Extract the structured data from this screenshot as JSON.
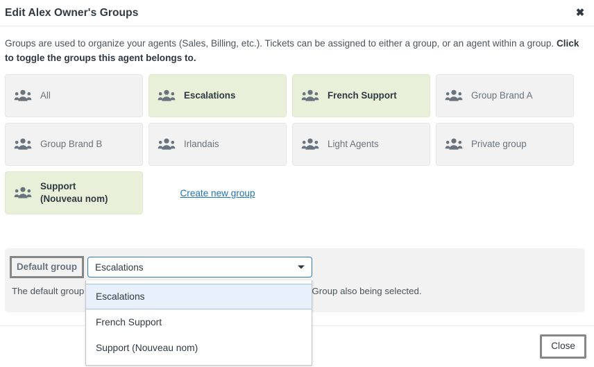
{
  "header": {
    "title": "Edit Alex Owner's Groups",
    "close_icon": "close-icon",
    "close_symbol": "✖"
  },
  "description": {
    "text_part1": "Groups are used to organize your agents (Sales, Billing, etc.). Tickets can be assigned to either a group, or an agent within a group. ",
    "text_bold": "Click to toggle the groups this agent belongs to."
  },
  "groups": {
    "icon_name": "people-group-icon",
    "tiles": [
      {
        "label": "All",
        "selected": false
      },
      {
        "label": "Escalations",
        "selected": true
      },
      {
        "label": "French Support",
        "selected": true
      },
      {
        "label": "Group Brand A",
        "selected": false
      },
      {
        "label": "Group Brand B",
        "selected": false
      },
      {
        "label": "Irlandais",
        "selected": false
      },
      {
        "label": "Light Agents",
        "selected": false
      },
      {
        "label": "Private group",
        "selected": false
      },
      {
        "label": "Support (Nouveau nom)",
        "selected": true
      }
    ],
    "create_link": "Create new group"
  },
  "default_group": {
    "label": "Default group",
    "selected_value": "Escalations",
    "helper_text": "The default group is applied to any ticket assigned to this agent without a Group also being selected.",
    "options": [
      "Escalations",
      "French Support",
      "Support (Nouveau nom)"
    ],
    "highlighted_option": "Escalations"
  },
  "footer": {
    "close_label": "Close"
  },
  "colors": {
    "selected_tile_bg": "#e9f0da",
    "tile_bg": "#f2f2f2",
    "link": "#1f73b7",
    "focus_border": "#868686",
    "select_border": "#337ab8",
    "option_highlight": "#e8f1fb"
  }
}
